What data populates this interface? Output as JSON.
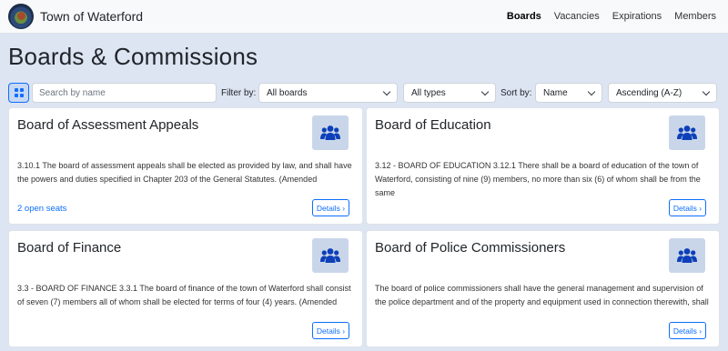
{
  "header": {
    "app_title": "Town of Waterford",
    "nav": [
      {
        "label": "Boards",
        "active": true
      },
      {
        "label": "Vacancies",
        "active": false
      },
      {
        "label": "Expirations",
        "active": false
      },
      {
        "label": "Members",
        "active": false
      }
    ]
  },
  "page_title": "Boards & Commissions",
  "toolbar": {
    "view_icon": "grid-icon",
    "search_placeholder": "Search by name",
    "filter_label": "Filter by:",
    "board_filter": "All boards",
    "type_filter": "All types",
    "sort_label": "Sort by:",
    "sort_field": "Name",
    "sort_order": "Ascending (A-Z)"
  },
  "cards": [
    {
      "title": "Board of Assessment Appeals",
      "icon": "users-icon",
      "description": "3.10.1 The board of assessment appeals shall be elected as provided by law, and shall have the powers and duties specified in Chapter 203 of the General Statutes. (Amended",
      "open_seats": "2 open seats",
      "details_label": "Details ›"
    },
    {
      "title": "Board of Education",
      "icon": "users-icon",
      "description": "3.12 - BOARD OF EDUCATION 3.12.1 There shall be a board of education of the town of Waterford, consisting of nine (9) members, no more than six (6) of whom shall be from the same",
      "open_seats": "",
      "details_label": "Details ›"
    },
    {
      "title": "Board of Finance",
      "icon": "users-icon",
      "description": "3.3 - BOARD OF FINANCE 3.3.1 The board of finance of the town of Waterford shall consist of seven (7) members all of whom shall be elected for terms of four (4) years. (Amended",
      "open_seats": "",
      "details_label": "Details ›"
    },
    {
      "title": "Board of Police Commissioners",
      "icon": "users-icon",
      "description": "The board of police commissioners shall have the general management and supervision of the police department and of the property and equipment used in connection therewith, shall",
      "open_seats": "",
      "details_label": "Details ›"
    }
  ],
  "colors": {
    "accent": "#0d6efd",
    "page_bg": "#dde5f3",
    "icon_tile": "#c9d6ea",
    "icon_fill": "#0d3fb8"
  }
}
